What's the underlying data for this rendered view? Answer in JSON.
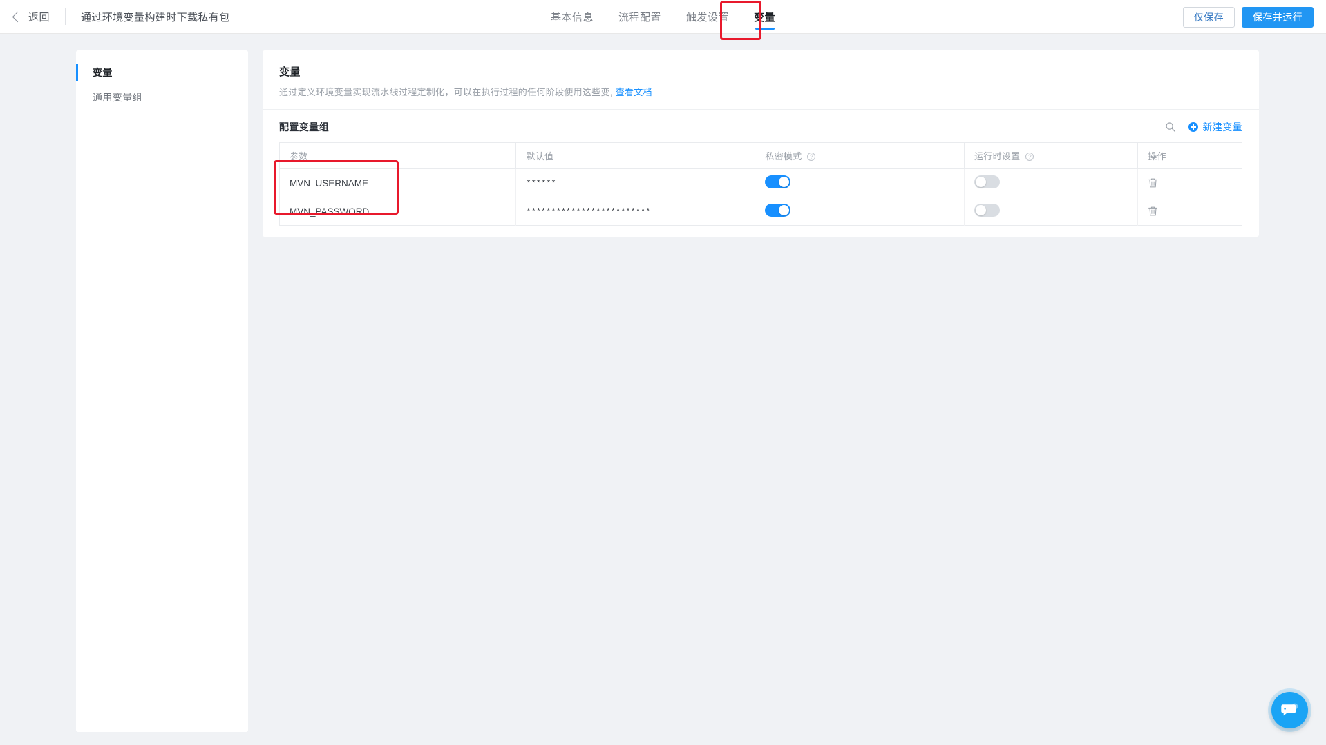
{
  "header": {
    "back_label": "返回",
    "page_title": "通过环境变量构建时下载私有包",
    "tabs": [
      {
        "label": "基本信息",
        "active": false
      },
      {
        "label": "流程配置",
        "active": false
      },
      {
        "label": "触发设置",
        "active": false
      },
      {
        "label": "变量",
        "active": true
      }
    ],
    "actions": {
      "save_only_label": "仅保存",
      "save_and_run_label": "保存并运行"
    }
  },
  "sidebar": {
    "items": [
      {
        "label": "变量",
        "active": true
      },
      {
        "label": "通用变量组",
        "active": false
      }
    ]
  },
  "main": {
    "title": "变量",
    "description": "通过定义环境变量实现流水线过程定制化，可以在执行过程的任何阶段使用这些变,",
    "doc_link_label": "查看文档",
    "section": {
      "title": "配置变量组",
      "search_icon": "search-icon",
      "add_label": "新建变量"
    },
    "table": {
      "columns": [
        {
          "label": "参数",
          "help": false
        },
        {
          "label": "默认值",
          "help": false
        },
        {
          "label": "私密模式",
          "help": true
        },
        {
          "label": "运行时设置",
          "help": true
        },
        {
          "label": "操作",
          "help": false
        }
      ],
      "rows": [
        {
          "param": "MVN_USERNAME",
          "value": "******",
          "secret_mode": true,
          "runtime_setting": false,
          "action_icon": "trash-icon"
        },
        {
          "param": "MVN_PASSWORD",
          "value": "*************************",
          "secret_mode": true,
          "runtime_setting": false,
          "action_icon": "trash-icon"
        }
      ]
    }
  },
  "chat": {
    "icon": "chat-bubble-icon"
  },
  "colors": {
    "accent": "#1890ff",
    "primary_button": "#2196f3",
    "annotation": "#e8192c",
    "toggle_on": "#1890ff",
    "toggle_off": "#d9dde2",
    "page_background": "#f0f2f5"
  }
}
